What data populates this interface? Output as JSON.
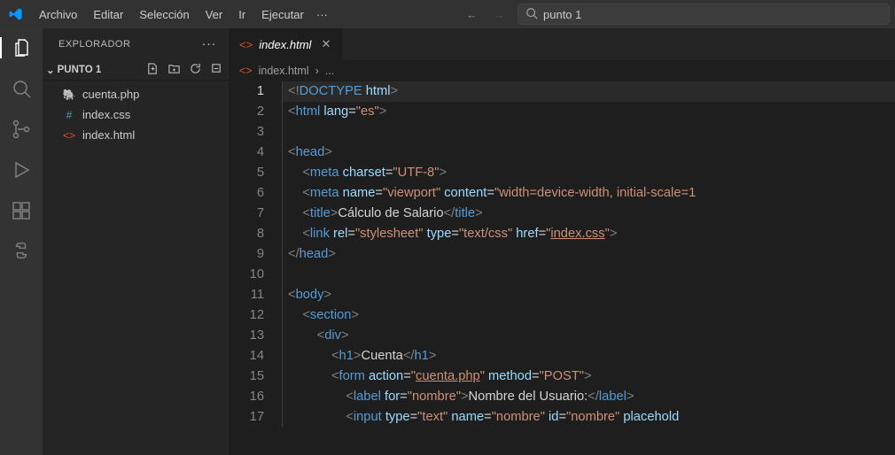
{
  "menu": [
    "Archivo",
    "Editar",
    "Selección",
    "Ver",
    "Ir",
    "Ejecutar"
  ],
  "search_value": "punto 1",
  "sidebar": {
    "title": "EXPLORADOR",
    "folder": "PUNTO 1",
    "files": [
      {
        "icon": "php",
        "name": "cuenta.php"
      },
      {
        "icon": "css",
        "name": "index.css"
      },
      {
        "icon": "html",
        "name": "index.html"
      }
    ]
  },
  "tab": {
    "name": "index.html"
  },
  "breadcrumb": {
    "file": "index.html",
    "sep": "›",
    "rest": "..."
  },
  "code": {
    "lines": [
      {
        "n": 1,
        "cur": true,
        "html": "<span class='t-delim'>&lt;!</span><span class='t-tag'>DOCTYPE</span> <span class='t-attr'>html</span><span class='t-delim'>&gt;</span>"
      },
      {
        "n": 2,
        "html": "<span class='t-delim'>&lt;</span><span class='t-tag'>html</span> <span class='t-attr'>lang</span><span class='t-txt'>=</span><span class='t-str'>\"es\"</span><span class='t-delim'>&gt;</span>"
      },
      {
        "n": 3,
        "html": ""
      },
      {
        "n": 4,
        "html": "<span class='t-delim'>&lt;</span><span class='t-tag'>head</span><span class='t-delim'>&gt;</span>"
      },
      {
        "n": 5,
        "html": "    <span class='t-delim'>&lt;</span><span class='t-tag'>meta</span> <span class='t-attr'>charset</span><span class='t-txt'>=</span><span class='t-str'>\"UTF-8\"</span><span class='t-delim'>&gt;</span>"
      },
      {
        "n": 6,
        "html": "    <span class='t-delim'>&lt;</span><span class='t-tag'>meta</span> <span class='t-attr'>name</span><span class='t-txt'>=</span><span class='t-str'>\"viewport\"</span> <span class='t-attr'>content</span><span class='t-txt'>=</span><span class='t-str'>\"width=device-width, initial-scale=1</span>"
      },
      {
        "n": 7,
        "html": "    <span class='t-delim'>&lt;</span><span class='t-tag'>title</span><span class='t-delim'>&gt;</span><span class='t-txt'>Cálculo de Salario</span><span class='t-delim'>&lt;/</span><span class='t-tag'>title</span><span class='t-delim'>&gt;</span>"
      },
      {
        "n": 8,
        "html": "    <span class='t-delim'>&lt;</span><span class='t-tag'>link</span> <span class='t-attr'>rel</span><span class='t-txt'>=</span><span class='t-str'>\"stylesheet\"</span> <span class='t-attr'>type</span><span class='t-txt'>=</span><span class='t-str'>\"text/css\"</span> <span class='t-attr'>href</span><span class='t-txt'>=</span><span class='t-str'>\"</span><span class='t-link'>index.css</span><span class='t-str'>\"</span><span class='t-delim'>&gt;</span>"
      },
      {
        "n": 9,
        "html": "<span class='t-delim'>&lt;/</span><span class='t-tag'>head</span><span class='t-delim'>&gt;</span>"
      },
      {
        "n": 10,
        "html": ""
      },
      {
        "n": 11,
        "html": "<span class='t-delim'>&lt;</span><span class='t-tag'>body</span><span class='t-delim'>&gt;</span>"
      },
      {
        "n": 12,
        "html": "    <span class='t-delim'>&lt;</span><span class='t-tag'>section</span><span class='t-delim'>&gt;</span>"
      },
      {
        "n": 13,
        "html": "        <span class='t-delim'>&lt;</span><span class='t-tag'>div</span><span class='t-delim'>&gt;</span>"
      },
      {
        "n": 14,
        "html": "            <span class='t-delim'>&lt;</span><span class='t-tag'>h1</span><span class='t-delim'>&gt;</span><span class='t-txt'>Cuenta</span><span class='t-delim'>&lt;/</span><span class='t-tag'>h1</span><span class='t-delim'>&gt;</span>"
      },
      {
        "n": 15,
        "html": "            <span class='t-delim'>&lt;</span><span class='t-tag'>form</span> <span class='t-attr'>action</span><span class='t-txt'>=</span><span class='t-str'>\"</span><span class='t-link'>cuenta.php</span><span class='t-str'>\"</span> <span class='t-attr'>method</span><span class='t-txt'>=</span><span class='t-str'>\"POST\"</span><span class='t-delim'>&gt;</span>"
      },
      {
        "n": 16,
        "html": "                <span class='t-delim'>&lt;</span><span class='t-tag'>label</span> <span class='t-attr'>for</span><span class='t-txt'>=</span><span class='t-str'>\"nombre\"</span><span class='t-delim'>&gt;</span><span class='t-txt'>Nombre del Usuario:</span><span class='t-delim'>&lt;/</span><span class='t-tag'>label</span><span class='t-delim'>&gt;</span>"
      },
      {
        "n": 17,
        "html": "                <span class='t-delim'>&lt;</span><span class='t-tag'>input</span> <span class='t-attr'>type</span><span class='t-txt'>=</span><span class='t-str'>\"text\"</span> <span class='t-attr'>name</span><span class='t-txt'>=</span><span class='t-str'>\"nombre\"</span> <span class='t-attr'>id</span><span class='t-txt'>=</span><span class='t-str'>\"nombre\"</span> <span class='t-attr'>placehold</span>"
      }
    ]
  }
}
